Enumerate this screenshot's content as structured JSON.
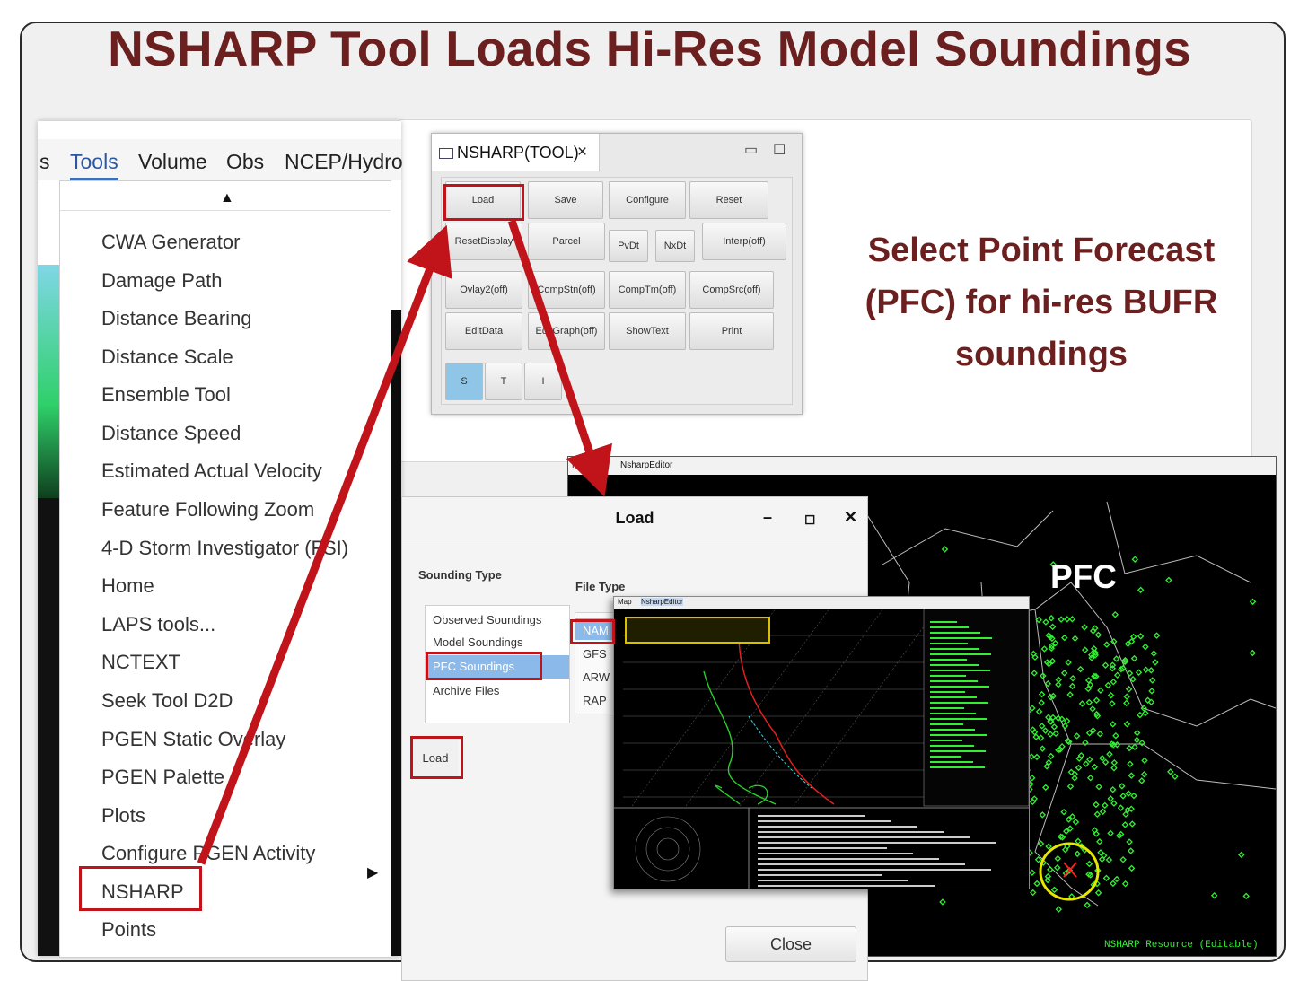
{
  "slide": {
    "title": "NSHARP Tool Loads Hi-Res Model Soundings",
    "side_note": [
      "Select Point Forecast",
      "(PFC) for hi-res BUFR",
      "soundings"
    ],
    "pfc_label": "PFC"
  },
  "menubar": {
    "partial_item": "s",
    "items": [
      "Tools",
      "Volume",
      "Obs",
      "NCEP/Hydro"
    ]
  },
  "menu": {
    "items": [
      "CWA Generator",
      "Damage Path",
      "Distance Bearing",
      "Distance Scale",
      "Ensemble Tool",
      "Distance Speed",
      "Estimated Actual Velocity",
      "Feature Following Zoom",
      "4-D Storm Investigator (FSI)",
      "Home",
      "LAPS tools...",
      "NCTEXT",
      "Seek Tool D2D",
      "PGEN Static Overlay",
      "PGEN Palette",
      "Plots",
      "Configure PGEN Activity",
      "NSHARP",
      "Points"
    ],
    "highlighted": "NSHARP"
  },
  "tool_window": {
    "tab_title": "NSHARP(TOOL)",
    "close_glyph": "×",
    "buttons": [
      "Load",
      "Save",
      "Configure",
      "Reset",
      "ResetDisplay",
      "Parcel",
      "PvDt",
      "NxDt",
      "Interp(off)",
      "Ovlay2(off)",
      "CompStn(off)",
      "CompTm(off)",
      "CompSrc(off)",
      "EditData",
      "EditGraph(off)",
      "ShowText",
      "Print",
      "S",
      "T",
      "I"
    ],
    "selected": "S"
  },
  "editor": {
    "tab_a": "Map",
    "tab_b": "NsharpEditor",
    "status": "NSHARP Resource (Editable)"
  },
  "load_dialog": {
    "title": "Load",
    "minimize": "–",
    "maximize": "◻",
    "close": "✕",
    "sounding_type_label": "Sounding Type",
    "file_type_label": "File Type",
    "sounding_types": [
      "Observed Soundings",
      "Model Soundings",
      "PFC Soundings",
      "Archive Files"
    ],
    "selected_sounding_type": "PFC Soundings",
    "file_types": [
      "NAM",
      "GFS",
      "ARW",
      "RAP"
    ],
    "load_button": "Load",
    "close_button": "Close"
  },
  "colors": {
    "title_maroon": "#6b1f1f",
    "annotation_red": "#c0141a",
    "highlight_yellow": "#e6e600",
    "map_green": "#33ee33"
  }
}
